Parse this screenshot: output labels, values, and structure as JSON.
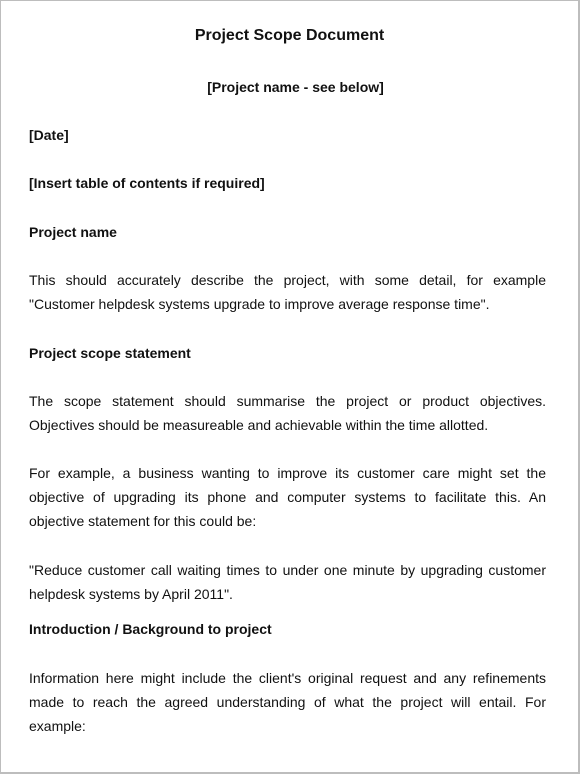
{
  "document": {
    "title": "Project Scope Document",
    "subtitle": "[Project name - see below]",
    "date_placeholder": "[Date]",
    "toc_placeholder": "[Insert table of contents if required]",
    "sections": [
      {
        "heading": "Project name",
        "paragraphs": [
          "This should accurately describe the project, with some detail, for example \"Customer helpdesk systems upgrade to improve average response time\"."
        ]
      },
      {
        "heading": "Project scope statement",
        "paragraphs": [
          "The scope statement should summarise the project or product objectives. Objectives should be measureable and achievable within the time allotted.",
          "For example, a business wanting to improve its customer care might set the objective of upgrading its phone and computer systems to facilitate this. An objective statement for this could be:",
          "\"Reduce customer call waiting times to under one minute by upgrading customer helpdesk systems by April 2011\"."
        ]
      },
      {
        "heading": "Introduction / Background to project",
        "paragraphs": [
          "Information here might include the client's original request and any refinements made to reach the agreed understanding of what the project will entail. For example:"
        ]
      }
    ]
  }
}
